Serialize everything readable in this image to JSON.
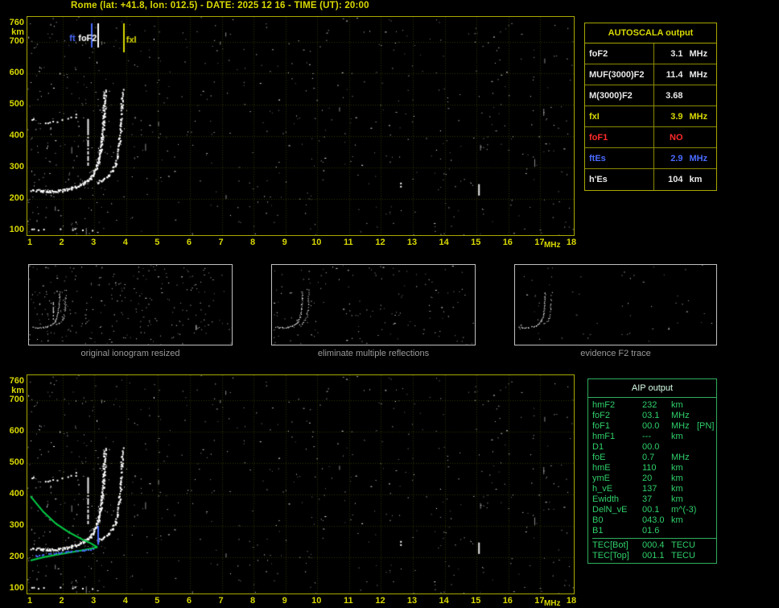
{
  "title": "Rome (lat: +41.8, lon: 012.5) - DATE: 2025 12 16 - TIME (UT): 20:00",
  "colors": {
    "axis_yellow": "#d8d800",
    "panel_border": "#a8a800",
    "grid": "rgba(190,190,0,0.28)",
    "trace_white": "#ffffff",
    "profile_green": "#00cc44",
    "fitted_blue": "#4a6bff",
    "aip_green": "#2fd06a",
    "caption_gray": "#9a9a9a",
    "alert_red": "#ff2a2a"
  },
  "autoscala": {
    "title": "AUTOSCALA output",
    "rows": [
      {
        "param": "foF2",
        "value": "3.1",
        "unit": "MHz",
        "color": "#e8e8e8"
      },
      {
        "param": "MUF(3000)F2",
        "value": "11.4",
        "unit": "MHz",
        "color": "#e8e8e8"
      },
      {
        "param": "M(3000)F2",
        "value": "3.68",
        "unit": "",
        "color": "#e8e8e8"
      },
      {
        "param": "fxI",
        "value": "3.9",
        "unit": "MHz",
        "color": "#d8d800"
      },
      {
        "param": "foF1",
        "value": "NO",
        "unit": "",
        "color": "#ff2a2a"
      },
      {
        "param": "ftEs",
        "value": "2.9",
        "unit": "MHz",
        "color": "#4a6bff"
      },
      {
        "param": "h'Es",
        "value": "104",
        "unit": "km",
        "color": "#e8e8e8"
      }
    ]
  },
  "thumbnails": [
    {
      "caption": "original ionogram resized"
    },
    {
      "caption": "eliminate multiple reflections"
    },
    {
      "caption": "evidence F2 trace"
    }
  ],
  "aip": {
    "title": "AIP output",
    "rows": [
      {
        "name": "hmF2",
        "value": "232",
        "unit": "km",
        "extra": ""
      },
      {
        "name": "foF2",
        "value": "03.1",
        "unit": "MHz",
        "extra": ""
      },
      {
        "name": "foF1",
        "value": "00.0",
        "unit": "MHz",
        "extra": "[PN]"
      },
      {
        "name": "hmF1",
        "value": "---",
        "unit": "km",
        "extra": ""
      },
      {
        "name": "D1",
        "value": "00.0",
        "unit": "",
        "extra": ""
      },
      {
        "name": "foE",
        "value": "0.7",
        "unit": "MHz",
        "extra": ""
      },
      {
        "name": "hmE",
        "value": "110",
        "unit": "km",
        "extra": ""
      },
      {
        "name": "ymE",
        "value": "20",
        "unit": "km",
        "extra": ""
      },
      {
        "name": "h_vE",
        "value": "137",
        "unit": "km",
        "extra": ""
      },
      {
        "name": "Ewidth",
        "value": "37",
        "unit": "km",
        "extra": ""
      },
      {
        "name": "DelN_vE",
        "value": "00.1",
        "unit": "m^(-3)",
        "extra": ""
      },
      {
        "name": "B0",
        "value": "043.0",
        "unit": "km",
        "extra": ""
      },
      {
        "name": "B1",
        "value": "01.6",
        "unit": "",
        "extra": ""
      }
    ],
    "tec_rows": [
      {
        "name": "TEC[Bot]",
        "value": "000.4",
        "unit": "TECU"
      },
      {
        "name": "TEC[Top]",
        "value": "001.1",
        "unit": "TECU"
      }
    ]
  },
  "chart_data": {
    "type": "scatter",
    "description": "Vertical-incidence ionogram (virtual height vs sounding frequency) with AUTOSCALA scaled parameters and AIP electron-density profile overlay",
    "x_axis": {
      "label": "MHz",
      "min": 1,
      "max": 18,
      "ticks": [
        1,
        2,
        3,
        4,
        5,
        6,
        7,
        8,
        9,
        10,
        11,
        12,
        13,
        14,
        15,
        16,
        17,
        18
      ]
    },
    "y_axis": {
      "label": "km",
      "min": 100,
      "max": 760,
      "ticks": [
        100,
        200,
        300,
        400,
        500,
        600,
        700,
        760
      ]
    },
    "scaled_parameters": {
      "foF2_MHz": 3.1,
      "MUF3000F2_MHz": 11.4,
      "M3000F2": 3.68,
      "fxI_MHz": 3.9,
      "foF1": "NO",
      "ftEs_MHz": 2.9,
      "hEs_km": 104,
      "hmF2_km": 232
    },
    "f2_trace_ordinary": [
      [
        1.0,
        231
      ],
      [
        1.3,
        227
      ],
      [
        1.6,
        225
      ],
      [
        1.9,
        227
      ],
      [
        2.1,
        231
      ],
      [
        2.3,
        236
      ],
      [
        2.5,
        243
      ],
      [
        2.7,
        253
      ],
      [
        2.85,
        266
      ],
      [
        2.95,
        281
      ],
      [
        3.05,
        301
      ],
      [
        3.12,
        326
      ],
      [
        3.18,
        357
      ],
      [
        3.23,
        397
      ],
      [
        3.27,
        441
      ],
      [
        3.3,
        492
      ],
      [
        3.32,
        545
      ]
    ],
    "f2_trace_extraordinary": [
      [
        3.05,
        252
      ],
      [
        3.25,
        263
      ],
      [
        3.45,
        278
      ],
      [
        3.55,
        293
      ],
      [
        3.65,
        314
      ],
      [
        3.72,
        345
      ],
      [
        3.78,
        386
      ],
      [
        3.82,
        437
      ],
      [
        3.85,
        497
      ],
      [
        3.87,
        562
      ]
    ],
    "second_hop_trace": [
      [
        1.0,
        452
      ],
      [
        1.5,
        448
      ],
      [
        2.0,
        452
      ],
      [
        2.3,
        462
      ],
      [
        2.5,
        476
      ]
    ],
    "es_trace": [
      [
        1.0,
        104
      ],
      [
        2.9,
        104
      ]
    ],
    "interference_streaks": [
      [
        15.05,
        212,
        247
      ],
      [
        2.78,
        308,
        455
      ],
      [
        12.6,
        238,
        252
      ]
    ],
    "scaled_markers": {
      "ftEs": {
        "freq_mhz": 2.9,
        "color": "#4a6bff",
        "label": "ft"
      },
      "foF2": {
        "freq_mhz": 3.1,
        "color": "#ffffff",
        "label": "foF2"
      },
      "fxI": {
        "freq_mhz": 3.9,
        "color": "#d8d800",
        "label": "fxI"
      }
    },
    "profile_bottomside": [
      [
        1.0,
        190
      ],
      [
        1.4,
        200
      ],
      [
        1.8,
        208
      ],
      [
        2.2,
        215
      ],
      [
        2.6,
        222
      ],
      [
        2.9,
        228
      ],
      [
        3.1,
        232
      ]
    ],
    "profile_topside": [
      [
        3.1,
        232
      ],
      [
        2.9,
        244
      ],
      [
        2.6,
        258
      ],
      [
        2.2,
        280
      ],
      [
        1.8,
        307
      ],
      [
        1.4,
        345
      ],
      [
        1.1,
        382
      ],
      [
        1.0,
        395
      ]
    ],
    "fitted_trace": [
      [
        1.15,
        206
      ],
      [
        1.6,
        212
      ],
      [
        2.1,
        218
      ],
      [
        2.6,
        224
      ],
      [
        3.0,
        229
      ]
    ],
    "noise": {
      "seed": 987654321,
      "main_count": 520,
      "left_cluster": 140,
      "streak_count": 16,
      "thumb_counts": [
        260,
        150,
        55
      ]
    }
  }
}
